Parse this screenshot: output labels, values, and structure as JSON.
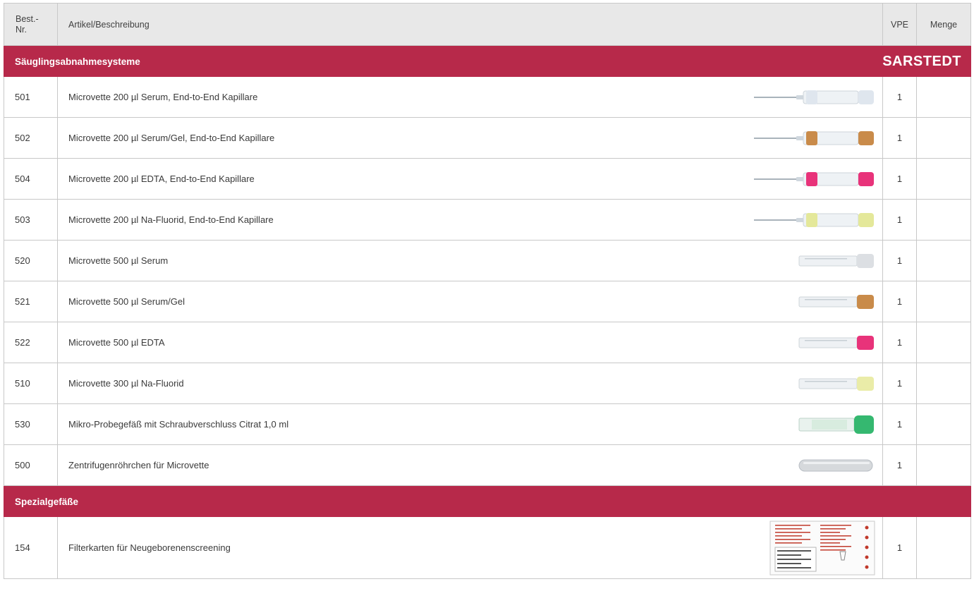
{
  "header": {
    "nr": "Best.-\nNr.",
    "nr_line1": "Best.-",
    "nr_line2": "Nr.",
    "description": "Artikel/Beschreibung",
    "vpe": "VPE",
    "quantity": "Menge"
  },
  "sections": [
    {
      "title": "Säuglingsabnahmesysteme",
      "brand": "SARSTEDT",
      "items": [
        {
          "nr": "501",
          "description": "Microvette 200 µl Serum, End-to-End Kapillare",
          "vpe": "1",
          "menge": "",
          "image": "microvette-capillary",
          "cap_color": "#dfe6ee"
        },
        {
          "nr": "502",
          "description": "Microvette 200 µl Serum/Gel, End-to-End Kapillare",
          "vpe": "1",
          "menge": "",
          "image": "microvette-capillary",
          "cap_color": "#c98b4a"
        },
        {
          "nr": "504",
          "description": "Microvette 200 µl EDTA, End-to-End Kapillare",
          "vpe": "1",
          "menge": "",
          "image": "microvette-capillary",
          "cap_color": "#e8337a"
        },
        {
          "nr": "503",
          "description": "Microvette 200 µl Na-Fluorid, End-to-End Kapillare",
          "vpe": "1",
          "menge": "",
          "image": "microvette-capillary",
          "cap_color": "#e4e89a"
        },
        {
          "nr": "520",
          "description": "Microvette 500 µl Serum",
          "vpe": "1",
          "menge": "",
          "image": "microvette-tube",
          "cap_color": "#dcdfe3"
        },
        {
          "nr": "521",
          "description": "Microvette 500 µl Serum/Gel",
          "vpe": "1",
          "menge": "",
          "image": "microvette-tube",
          "cap_color": "#c98b4a"
        },
        {
          "nr": "522",
          "description": "Microvette 500 µl EDTA",
          "vpe": "1",
          "menge": "",
          "image": "microvette-tube",
          "cap_color": "#e8337a"
        },
        {
          "nr": "510",
          "description": "Microvette 300 µl Na-Fluorid",
          "vpe": "1",
          "menge": "",
          "image": "microvette-tube",
          "cap_color": "#eaeca8"
        },
        {
          "nr": "530",
          "description": "Mikro-Probegefäß mit Schraubverschluss Citrat 1,0 ml",
          "vpe": "1",
          "menge": "",
          "image": "screw-cap-tube",
          "cap_color": "#35b870"
        },
        {
          "nr": "500",
          "description": "Zentrifugenröhrchen für Microvette",
          "vpe": "1",
          "menge": "",
          "image": "centrifuge-tube",
          "cap_color": "#d6d9dc"
        }
      ]
    },
    {
      "title": "Spezialgefäße",
      "brand": "",
      "items": [
        {
          "nr": "154",
          "description": "Filterkarten für Neugeborenenscreening",
          "vpe": "1",
          "menge": "",
          "image": "filter-card",
          "cap_color": "#c0392b"
        }
      ]
    }
  ]
}
